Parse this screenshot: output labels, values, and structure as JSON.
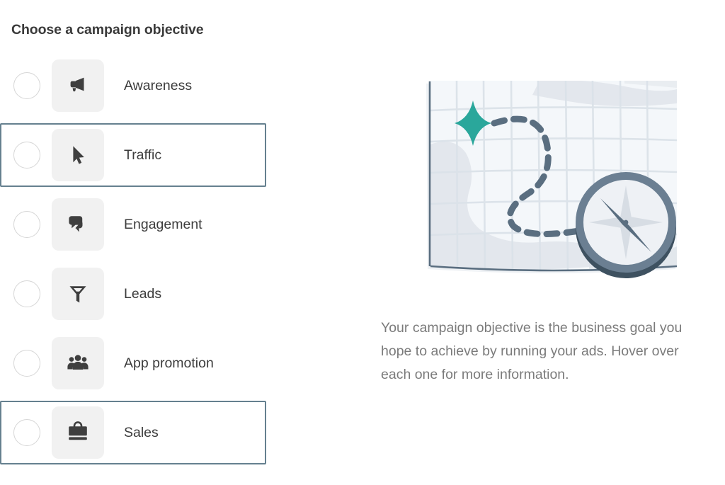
{
  "page": {
    "title": "Choose a campaign objective"
  },
  "objectives": {
    "items": [
      {
        "id": "awareness",
        "label": "Awareness",
        "icon": "megaphone-icon",
        "selected": false
      },
      {
        "id": "traffic",
        "label": "Traffic",
        "icon": "cursor-arrow-icon",
        "selected": true
      },
      {
        "id": "engagement",
        "label": "Engagement",
        "icon": "speech-bubbles-icon",
        "selected": false
      },
      {
        "id": "leads",
        "label": "Leads",
        "icon": "funnel-icon",
        "selected": false
      },
      {
        "id": "app_promotion",
        "label": "App promotion",
        "icon": "people-group-icon",
        "selected": false
      },
      {
        "id": "sales",
        "label": "Sales",
        "icon": "briefcase-icon",
        "selected": false
      }
    ]
  },
  "info": {
    "illustration_name": "map-with-compass-illustration",
    "description": "Your campaign objective is the business goal you hope to achieve by running your ads. Hover over each one for more information."
  },
  "colors": {
    "selected_border": "#65808f",
    "icon_tile_background": "#f1f1f1",
    "icon_glyph": "#3f3f3f",
    "radio_border": "#d6d6d6",
    "title_text": "#3a3a3a",
    "label_text": "#3c3c3c",
    "description_text": "#7b7b7b",
    "illustration_accent_teal": "#2aa79b",
    "illustration_slate": "#5a6e80",
    "illustration_dark_slate": "#3e5160",
    "illustration_map_paper": "#f4f7fa"
  }
}
